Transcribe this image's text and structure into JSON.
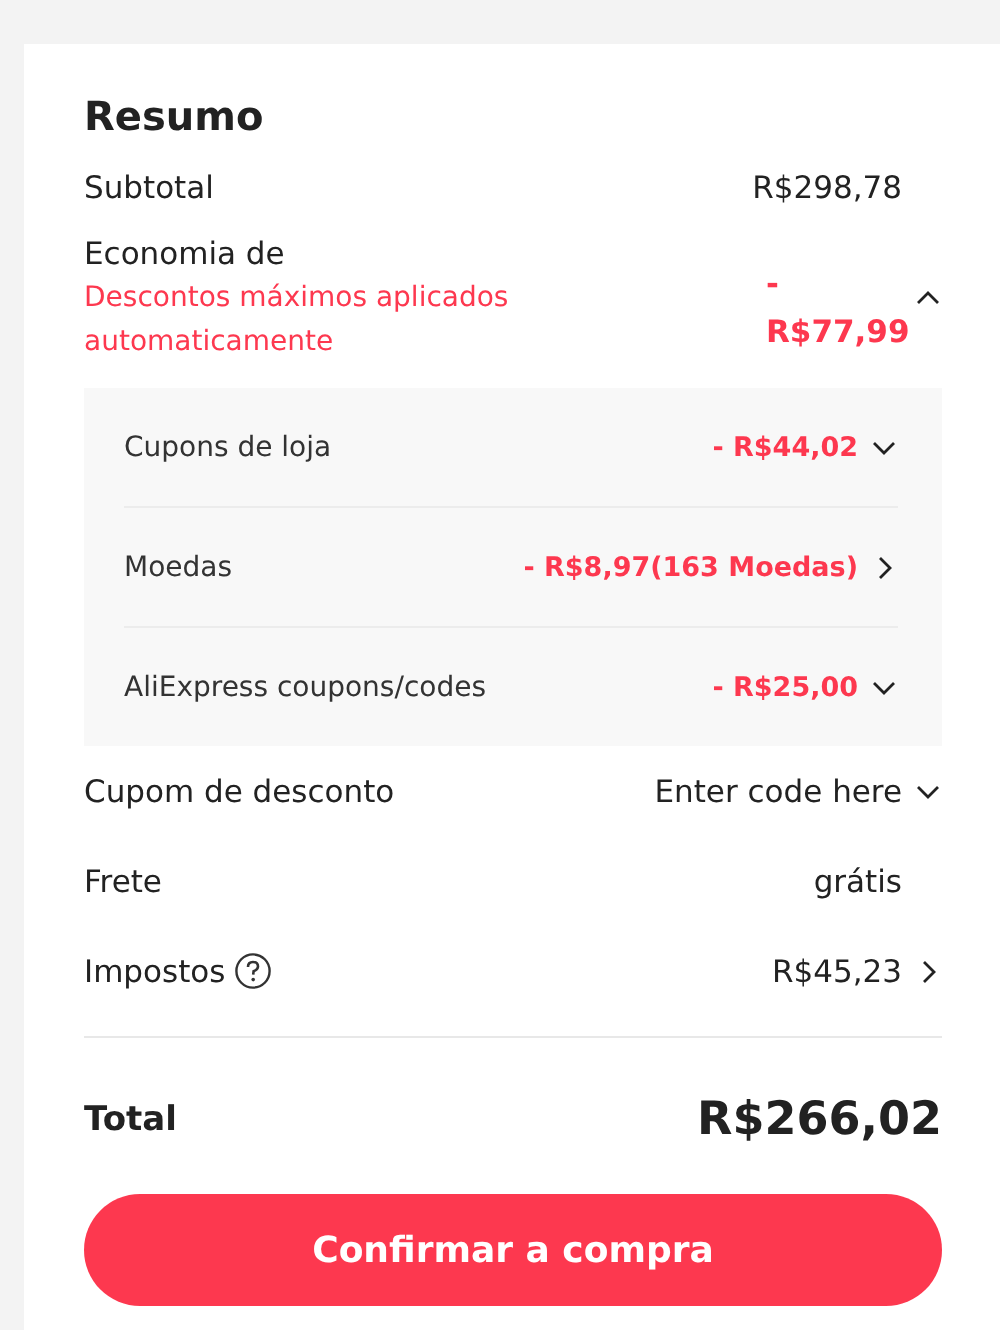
{
  "title": "Resumo",
  "subtotal": {
    "label": "Subtotal",
    "value": "R$298,78"
  },
  "savings": {
    "label": "Economia de",
    "note": "Descontos máximos aplicados automaticamente",
    "value": "- R$77,99",
    "expanded": true,
    "items": [
      {
        "label": "Cupons de loja",
        "value": "- R$44,02",
        "expands": true
      },
      {
        "label": "Moedas",
        "value": "- R$8,97(163 Moedas)",
        "expands": false
      },
      {
        "label": "AliExpress coupons/codes",
        "value": "- R$25,00",
        "expands": true
      }
    ]
  },
  "rows": [
    {
      "kind": "coupon",
      "label": "Cupom de desconto",
      "placeholder": "Enter code here",
      "expands": true
    },
    {
      "kind": "plain",
      "label": "Frete",
      "value": "grátis"
    },
    {
      "kind": "tax",
      "label": "Impostos",
      "value": "R$45,23",
      "expands": false
    }
  ],
  "total": {
    "label": "Total",
    "value": "R$266,02"
  },
  "button": "Confirmar a compra"
}
